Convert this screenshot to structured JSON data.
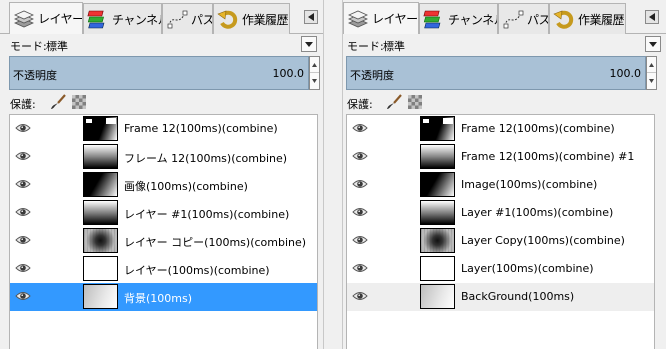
{
  "panels": [
    {
      "tabs": [
        {
          "label": "レイヤー",
          "icon": "layers-icon"
        },
        {
          "label": "チャンネル",
          "icon": "channels-icon"
        },
        {
          "label": "パス",
          "icon": "paths-icon"
        },
        {
          "label": "作業履歴",
          "icon": "undo-history-icon"
        }
      ],
      "mode_label": "モード:",
      "mode_value": "標準",
      "opacity_label": "不透明度",
      "opacity_value": "100.0",
      "protect_label": "保護:",
      "layers": [
        {
          "name": "Frame 12(100ms)(combine)",
          "thumb": "frame"
        },
        {
          "name": "フレーム 12(100ms)(combine)",
          "thumb": "hgrad"
        },
        {
          "name": "画像(100ms)(combine)",
          "thumb": "diag"
        },
        {
          "name": "レイヤー #1(100ms)(combine)",
          "thumb": "hgrad2"
        },
        {
          "name": "レイヤー コピー(100ms)(combine)",
          "thumb": "radial"
        },
        {
          "name": "レイヤー(100ms)(combine)",
          "thumb": "white"
        },
        {
          "name": "背景(100ms)",
          "thumb": "light",
          "selected": true
        }
      ]
    },
    {
      "tabs": [
        {
          "label": "レイヤー",
          "icon": "layers-icon"
        },
        {
          "label": "チャンネル",
          "icon": "channels-icon"
        },
        {
          "label": "パス",
          "icon": "paths-icon"
        },
        {
          "label": "作業履歴",
          "icon": "undo-history-icon"
        }
      ],
      "mode_label": "モード:",
      "mode_value": "標準",
      "opacity_label": "不透明度",
      "opacity_value": "100.0",
      "protect_label": "保護:",
      "layers": [
        {
          "name": "Frame 12(100ms)(combine)",
          "thumb": "frame"
        },
        {
          "name": "Frame 12(100ms)(combine) #1",
          "thumb": "hgrad"
        },
        {
          "name": "Image(100ms)(combine)",
          "thumb": "diag"
        },
        {
          "name": "Layer #1(100ms)(combine)",
          "thumb": "hgrad2"
        },
        {
          "name": "Layer Copy(100ms)(combine)",
          "thumb": "radial"
        },
        {
          "name": "Layer(100ms)(combine)",
          "thumb": "white"
        },
        {
          "name": "BackGround(100ms)",
          "thumb": "light",
          "highlighted": true
        }
      ]
    }
  ],
  "colors": {
    "selection": "#3399ff",
    "opacity_bar": "#a9c1d6"
  }
}
